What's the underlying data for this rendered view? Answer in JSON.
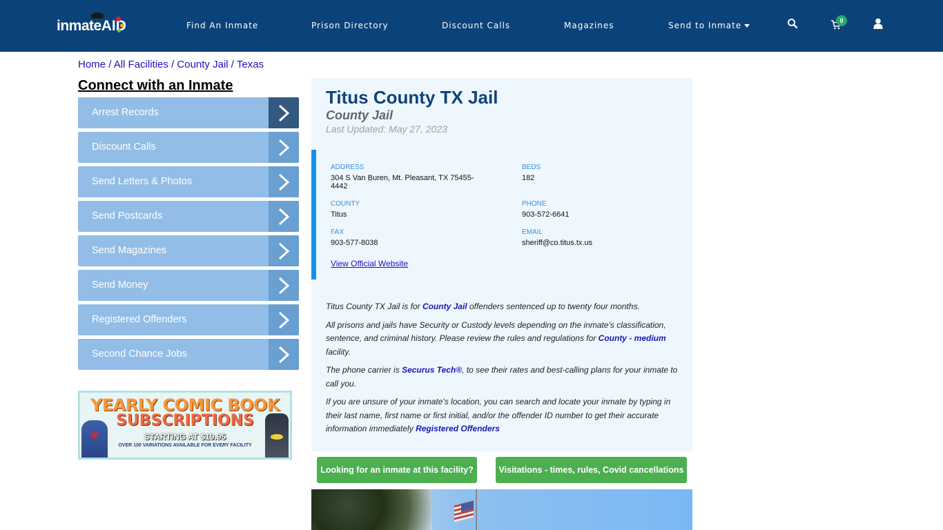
{
  "header": {
    "logo_main": "inmate",
    "logo_accent": "AID",
    "nav": [
      {
        "label": "Find An Inmate"
      },
      {
        "label": "Prison Directory"
      },
      {
        "label": "Discount Calls"
      },
      {
        "label": "Magazines"
      },
      {
        "label": "Send to Inmate",
        "has_dropdown": true
      }
    ],
    "icons": {
      "search": "search-icon",
      "cart": "cart-icon",
      "user": "user-icon"
    },
    "cart_count": "0"
  },
  "breadcrumb": [
    {
      "label": "Home"
    },
    {
      "label": "All Facilities"
    },
    {
      "label": "County Jail"
    },
    {
      "label": "Texas"
    }
  ],
  "breadcrumb_separator": "/",
  "sidebar": {
    "title": "Connect with an Inmate",
    "items": [
      {
        "label": "Arrest Records"
      },
      {
        "label": "Discount Calls"
      },
      {
        "label": "Send Letters & Photos"
      },
      {
        "label": "Send Postcards"
      },
      {
        "label": "Send Magazines"
      },
      {
        "label": "Send Money"
      },
      {
        "label": "Registered Offenders"
      },
      {
        "label": "Second Chance Jobs"
      }
    ],
    "ad": {
      "line1": "YEARLY COMIC BOOK",
      "line2": "SUBSCRIPTIONS",
      "line3": "STARTING AT $19.95",
      "line4": "OVER 100 VARIATIONS AVAILABLE FOR EVERY FACILITY"
    }
  },
  "facility": {
    "title": "Titus County TX Jail",
    "type": "County Jail",
    "last_updated": "Last Updated: May 27, 2023",
    "info": {
      "address_label": "ADDRESS",
      "address_line1": "304 S Van Buren, Mt. Pleasant, TX 75455-",
      "address_line2": "4442",
      "beds_label": "BEDS",
      "beds": "182",
      "county_label": "COUNTY",
      "county": "Titus",
      "phone_label": "PHONE",
      "phone": "903-572-6641",
      "fax_label": "FAX",
      "fax": "903-577-8038",
      "email_label": "EMAIL",
      "email": "sheriff@co.titus.tx.us",
      "website_link": "View Official Website"
    },
    "description": {
      "p1_a": "Titus County TX Jail is for ",
      "p1_link": "County Jail",
      "p1_b": " offenders sentenced up to twenty four months.",
      "p2_a": "All prisons and jails have Security or Custody levels depending on the inmate's classification, sentence, and criminal history. Please review the rules and regulations for ",
      "p2_link": "County - medium",
      "p2_b": " facility.",
      "p3_a": "The phone carrier is ",
      "p3_link": "Securus Tech®",
      "p3_b": ", to see their rates and best-calling plans for your inmate to call you.",
      "p4_a": "If you are unsure of your inmate's location, you can search and locate your inmate by typing in their last name, first name or first initial, and/or the offender ID number to get their accurate information immediately ",
      "p4_link": "Registered Offenders"
    },
    "buttons": {
      "find_inmate": "Looking for an inmate at this facility?",
      "visitations": "Visitations - times, rules, Covid cancellations"
    }
  },
  "colors": {
    "header_bg": "#0b4279",
    "sidebar_item": "#92bde6",
    "sidebar_arrow": "#6a9fd1",
    "sidebar_arrow_active": "#33597f",
    "panel_bg": "#eef7fe",
    "accent_blue": "#1590ee",
    "button_green": "#4caf50",
    "title_blue": "#0e4377"
  }
}
